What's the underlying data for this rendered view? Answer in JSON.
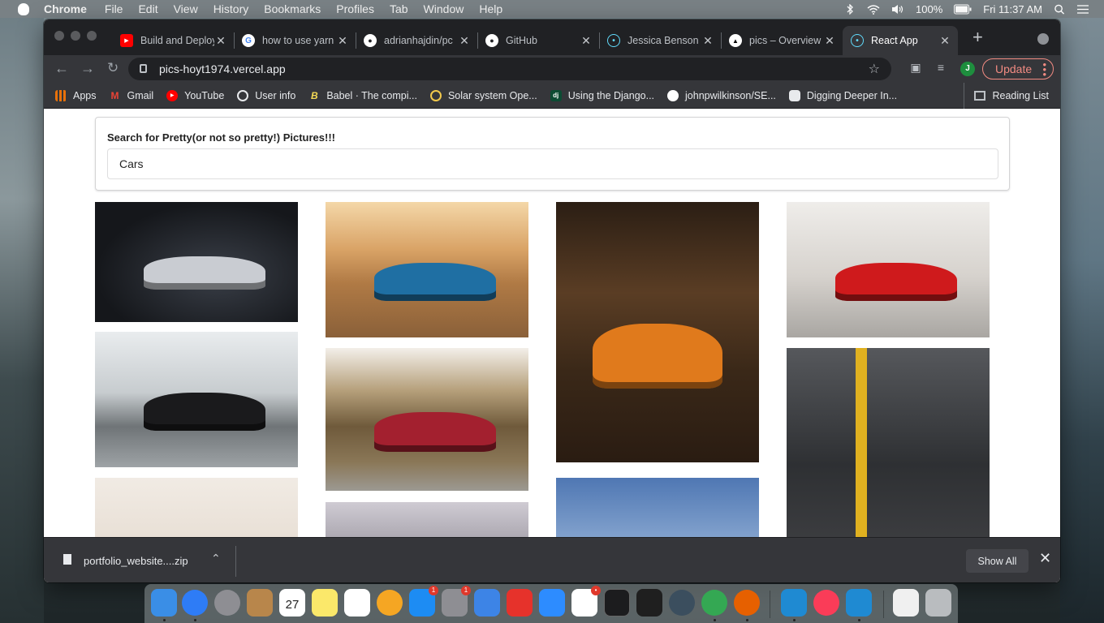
{
  "menubar": {
    "app_name": "Chrome",
    "items": [
      "File",
      "Edit",
      "View",
      "History",
      "Bookmarks",
      "Profiles",
      "Tab",
      "Window",
      "Help"
    ],
    "battery": "100%",
    "clock": "Fri 11:37 AM"
  },
  "tabs": [
    {
      "label": "Build and Deploy",
      "icon": "youtube-icon",
      "color": "#ff0000"
    },
    {
      "label": "how to use yarn",
      "icon": "google-icon",
      "color": "#ffffff"
    },
    {
      "label": "adrianhajdin/pc",
      "icon": "github-icon",
      "color": "#ffffff"
    },
    {
      "label": "GitHub",
      "icon": "github-icon",
      "color": "#ffffff"
    },
    {
      "label": "Jessica Benson",
      "icon": "react-icon",
      "color": "#61dafb"
    },
    {
      "label": "pics – Overview",
      "icon": "vercel-icon",
      "color": "#ffffff"
    },
    {
      "label": "React App",
      "icon": "react-icon",
      "color": "#61dafb"
    }
  ],
  "address_bar": {
    "url": "pics-hoyt1974.vercel.app"
  },
  "toolbar": {
    "profile_initial": "J",
    "update_label": "Update"
  },
  "bookmarks": [
    {
      "label": "Apps",
      "icon": "apps-grid-icon",
      "color": "#e8710a"
    },
    {
      "label": "Gmail",
      "icon": "gmail-icon",
      "color": "#ea4335"
    },
    {
      "label": "YouTube",
      "icon": "youtube-icon",
      "color": "#ff0000"
    },
    {
      "label": "User info",
      "icon": "globe-icon",
      "color": "#e8eaed"
    },
    {
      "label": "Babel · The compi...",
      "icon": "babel-icon",
      "color": "#f5da55"
    },
    {
      "label": "Solar system Ope...",
      "icon": "solar-icon",
      "color": "#f2c94c"
    },
    {
      "label": "Using the Django...",
      "icon": "django-icon",
      "color": "#0c4b33"
    },
    {
      "label": "johnpwilkinson/SE...",
      "icon": "github-icon",
      "color": "#ffffff"
    },
    {
      "label": "Digging Deeper In...",
      "icon": "puzzle-icon",
      "color": "#e8eaed"
    }
  ],
  "reading_list": "Reading List",
  "search": {
    "label": "Search for Pretty(or not so pretty!) Pictures!!!",
    "value": "Cars"
  },
  "images": [
    {
      "name": "white-camaro-garage",
      "bg": "#1b1d22",
      "accent": "#c9ccd2"
    },
    {
      "name": "black-porsche-road",
      "bg": "#cfd3d6",
      "accent": "#1a1a1c"
    },
    {
      "name": "pale-car-partial",
      "bg": "#eee6dd",
      "accent": "#e6ddd2"
    },
    {
      "name": "blue-camaro-desert",
      "bg": "#b48555",
      "accent": "#1f6fa3"
    },
    {
      "name": "red-amg-forest",
      "bg": "#7d6a4c",
      "accent": "#a3202f"
    },
    {
      "name": "grey-car-partial",
      "bg": "#c4c1c8",
      "accent": "#9c98a0"
    },
    {
      "name": "orange-lamborghini-forest",
      "bg": "#3b2a1d",
      "accent": "#e07a1c"
    },
    {
      "name": "sky-car-partial",
      "bg": "#5d82ba",
      "accent": "#7c9cc8"
    },
    {
      "name": "red-laferrari-showroom",
      "bg": "#d9d6d2",
      "accent": "#cf1a1c"
    },
    {
      "name": "grey-mercedes-stripe",
      "bg": "#3c3d40",
      "accent": "#e0b120"
    }
  ],
  "download": {
    "filename": "portfolio_website....zip",
    "show_all": "Show All"
  },
  "dock": [
    {
      "name": "finder-icon",
      "color": "#3a8ee6"
    },
    {
      "name": "safari-icon",
      "color": "#2e7cf6"
    },
    {
      "name": "launchpad-icon",
      "color": "#8e8e93"
    },
    {
      "name": "contacts-icon",
      "color": "#b8864b"
    },
    {
      "name": "calendar-icon",
      "color": "#ffffff",
      "text": "27"
    },
    {
      "name": "notes-icon",
      "color": "#fbe86a"
    },
    {
      "name": "reminders-icon",
      "color": "#ffffff"
    },
    {
      "name": "photos-icon",
      "color": "#f5a623"
    },
    {
      "name": "app-store-icon",
      "color": "#1d8cf3",
      "badge": "1"
    },
    {
      "name": "system-preferences-icon",
      "color": "#8e8e93",
      "badge": "1"
    },
    {
      "name": "xcode-icon",
      "color": "#3d84e6"
    },
    {
      "name": "mail-icon",
      "color": "#e6322b"
    },
    {
      "name": "zoom-icon",
      "color": "#2d8cff"
    },
    {
      "name": "slack-icon",
      "color": "#ffffff",
      "badge": "•"
    },
    {
      "name": "terminal-icon",
      "color": "#1c1c1e"
    },
    {
      "name": "pycharm-icon",
      "color": "#1f1f1f"
    },
    {
      "name": "edge-icon",
      "color": "#3b4e5e"
    },
    {
      "name": "chrome-icon",
      "color": "#34a853"
    },
    {
      "name": "firefox-icon",
      "color": "#e66000"
    },
    {
      "name": "vscode-icon",
      "color": "#1f8ad2"
    },
    {
      "name": "music-icon",
      "color": "#fa3c58"
    },
    {
      "name": "vscode-insiders-icon",
      "color": "#1f8ad2"
    },
    {
      "name": "screenshot-icon",
      "color": "#f0f0f0"
    },
    {
      "name": "trash-icon",
      "color": "#b9bcbf"
    }
  ]
}
